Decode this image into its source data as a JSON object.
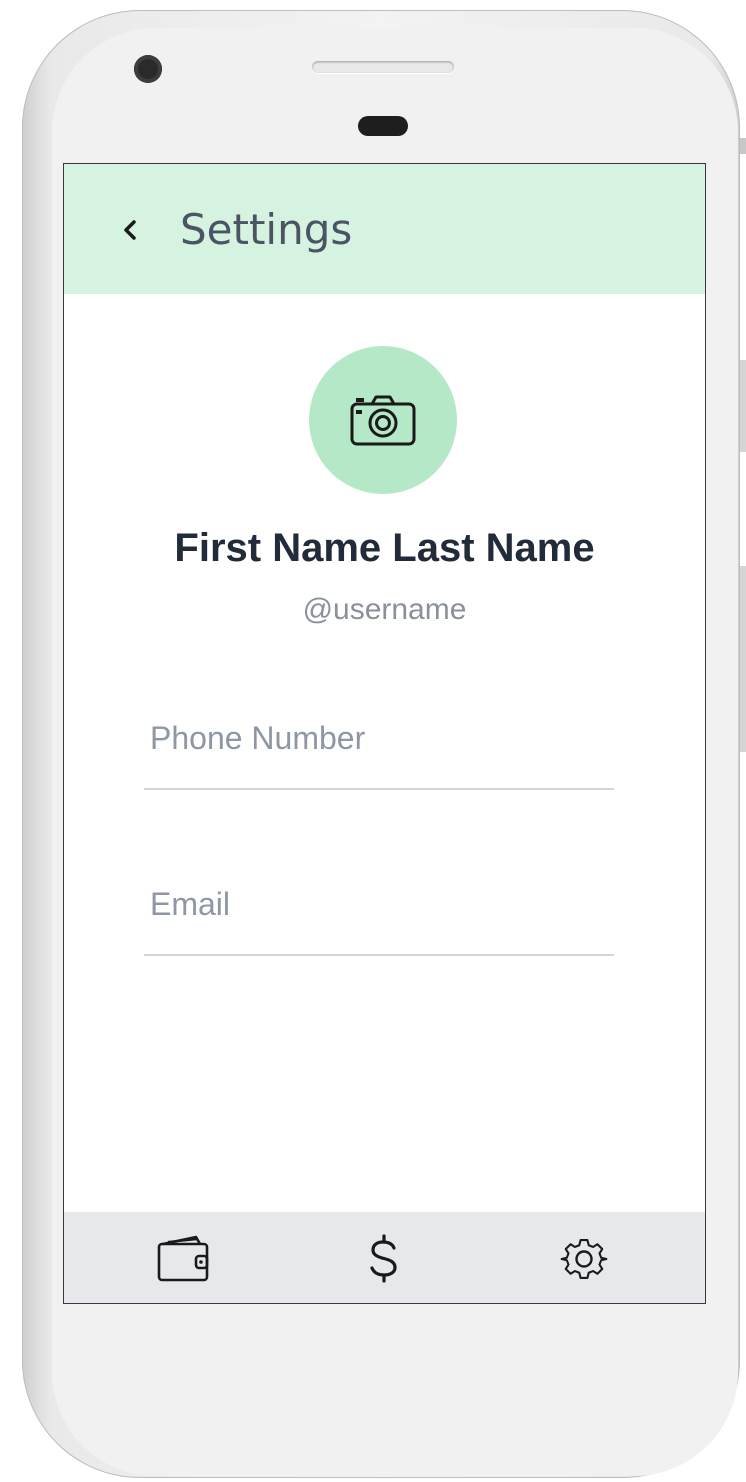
{
  "header": {
    "title": "Settings",
    "back_icon": "chevron-left-icon",
    "background": "#d6f2e0"
  },
  "profile": {
    "avatar_icon": "camera-icon",
    "avatar_color": "#b4e8c6",
    "full_name": "First Name Last Name",
    "username": "@username"
  },
  "form": {
    "phone": {
      "placeholder": "Phone Number",
      "value": ""
    },
    "email": {
      "placeholder": "Email",
      "value": ""
    }
  },
  "tabbar": {
    "items": [
      {
        "icon": "wallet-icon"
      },
      {
        "icon": "dollar-icon"
      },
      {
        "icon": "gear-icon"
      }
    ]
  }
}
